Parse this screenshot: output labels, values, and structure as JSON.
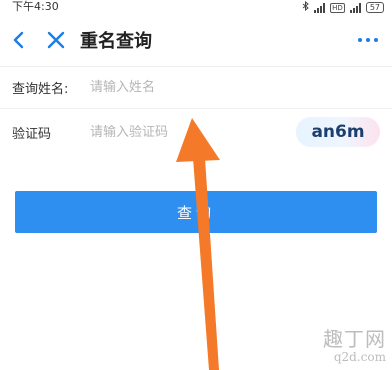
{
  "statusbar": {
    "time": "下午4:30",
    "icons": [
      "bluetooth-icon",
      "signal-icon",
      "hd-icon",
      "signal-icon"
    ],
    "hd_label": "HD",
    "battery": "57"
  },
  "navbar": {
    "title": "重名查询",
    "accent_color": "#1a7ee6"
  },
  "form": {
    "name_label": "查询姓名:",
    "name_placeholder": "请输入姓名",
    "code_label": "验证码",
    "code_placeholder": "请输入验证码",
    "captcha_text": "an6m"
  },
  "query_button_label": "查询",
  "button_color": "#2f8ff0",
  "annotation_color": "#f47a2a",
  "watermark": {
    "title": "趣丁网",
    "url": "q2d.com"
  }
}
